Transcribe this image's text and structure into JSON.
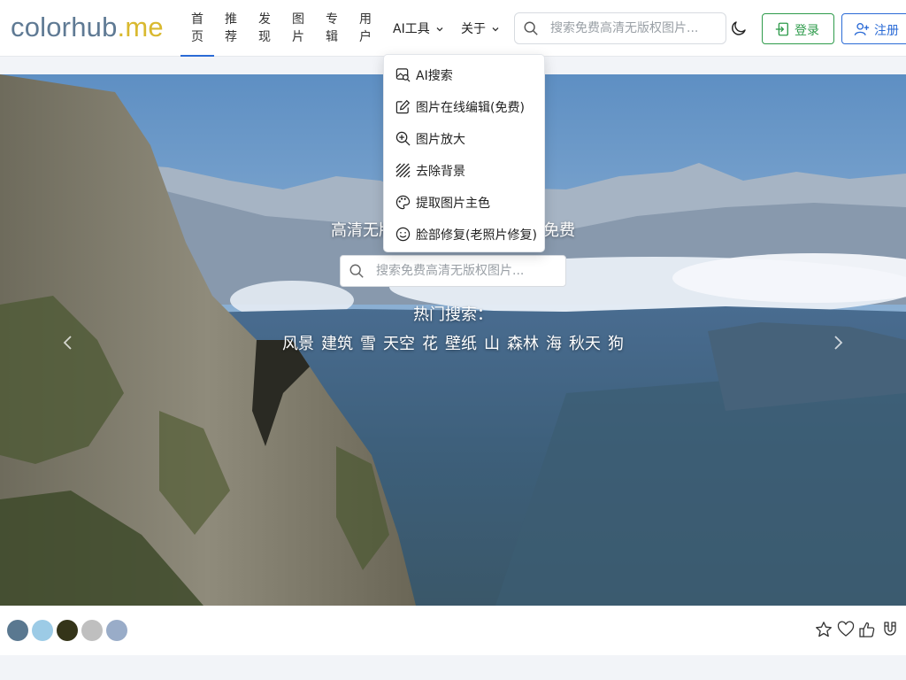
{
  "header": {
    "logo_part1": "colorhub",
    "logo_part2": ".me",
    "nav": [
      {
        "top": "首",
        "bottom": "页"
      },
      {
        "top": "推",
        "bottom": "荐"
      },
      {
        "top": "发",
        "bottom": "现"
      },
      {
        "top": "图",
        "bottom": "片"
      },
      {
        "top": "专",
        "bottom": "辑"
      },
      {
        "top": "用",
        "bottom": "户"
      }
    ],
    "ai_tools_label": "AI工具",
    "about_label": "关于",
    "search_placeholder": "搜索免费高清无版权图片...",
    "login_label": "登录",
    "register_label": "注册"
  },
  "ai_menu": {
    "items": [
      {
        "label": "AI搜索",
        "icon": "image-search-icon"
      },
      {
        "label": "图片在线编辑(免费)",
        "icon": "edit-icon"
      },
      {
        "label": "图片放大",
        "icon": "zoom-in-icon"
      },
      {
        "label": "去除背景",
        "icon": "remove-background-icon"
      },
      {
        "label": "提取图片主色",
        "icon": "palette-icon"
      },
      {
        "label": "脸部修复(老照片修复)",
        "icon": "face-icon"
      }
    ]
  },
  "hero": {
    "title_left": "高清无版",
    "title_right": "途免费",
    "search_placeholder": "搜索免费高清无版权图片...",
    "hot_title": "热门搜索：",
    "hot_tags": [
      "风景",
      "建筑",
      "雪",
      "天空",
      "花",
      "壁纸",
      "山",
      "森林",
      "海",
      "秋天",
      "狗"
    ]
  },
  "palette": {
    "colors": [
      "#5a7890",
      "#9ccbe6",
      "#343419",
      "#bfbfbf",
      "#99acc8"
    ]
  },
  "colors": {
    "accent_blue": "#2b6bd6",
    "accent_green": "#2e9b4b",
    "logo_gray": "#5f7a94",
    "logo_yellow": "#d9b92f"
  }
}
